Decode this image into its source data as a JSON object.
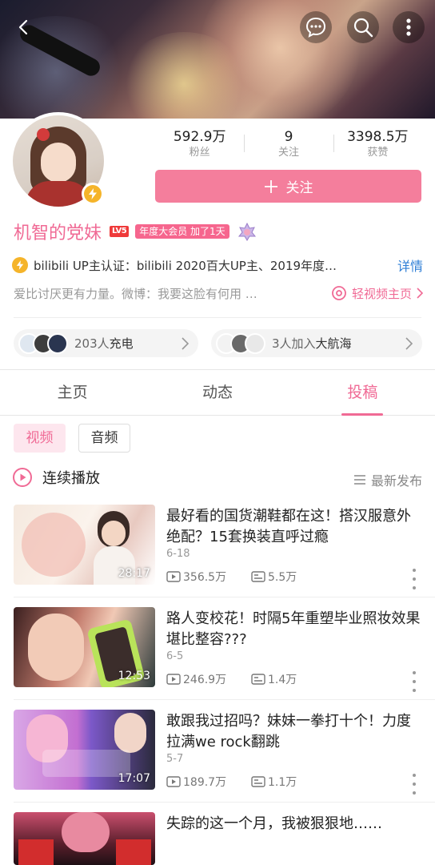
{
  "header": {
    "back_icon": "chevron-left-icon",
    "actions": [
      "message-icon",
      "search-icon",
      "more-vertical-icon"
    ]
  },
  "profile": {
    "stats": [
      {
        "value": "592.9万",
        "label": "粉丝"
      },
      {
        "value": "9",
        "label": "关注"
      },
      {
        "value": "3398.5万",
        "label": "获赞"
      }
    ],
    "follow_button": "关注",
    "name": "机智的党妹",
    "level_badge": "LV5",
    "vip_badge": "年度大会员 加了1天",
    "certification": "bilibili UP主认证：bilibili 2020百大UP主、2019年度…",
    "certification_more": "详情",
    "signature": "爱比讨厌更有力量。微博：我要这脸有何用 …",
    "light_video_link": "轻视频主页"
  },
  "social": {
    "charge": {
      "count": "203人",
      "label": "充电"
    },
    "fleet": {
      "count": "3人加入",
      "label": "大航海"
    }
  },
  "tabs": [
    "主页",
    "动态",
    "投稿"
  ],
  "active_tab": "投稿",
  "sub_tabs": [
    "视频",
    "音频"
  ],
  "playall_label": "连续播放",
  "sort_label": "最新发布",
  "videos": [
    {
      "title": "最好看的国货潮鞋都在这！搭汉服意外绝配？15套换装直呼过瘾",
      "date": "6-18",
      "duration": "28:17",
      "views": "356.5万",
      "danmaku": "5.5万"
    },
    {
      "title": "路人变校花！时隔5年重塑毕业照妆效果堪比整容???",
      "date": "6-5",
      "duration": "12:53",
      "views": "246.9万",
      "danmaku": "1.4万"
    },
    {
      "title": "敢跟我过招吗？妹妹一拳打十个！力度拉满we rock翻跳",
      "date": "5-7",
      "duration": "17:07",
      "views": "189.7万",
      "danmaku": "1.1万"
    },
    {
      "title": "失踪的这一个月，我被狠狠地……",
      "date": "",
      "duration": "",
      "views": "",
      "danmaku": ""
    }
  ],
  "colors": {
    "accent": "#f06a95",
    "follow_button": "#f47e9c",
    "link_blue": "#2f7fd6",
    "gold": "#f5b42a"
  }
}
